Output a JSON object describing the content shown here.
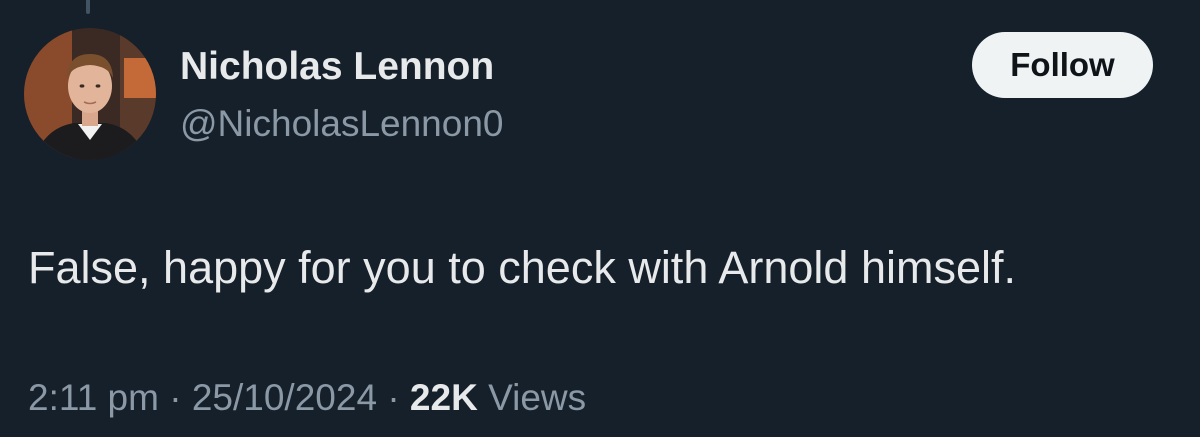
{
  "author": {
    "name": "Nicholas Lennon",
    "handle": "@NicholasLennon0"
  },
  "follow_button": {
    "label": "Follow"
  },
  "post": {
    "text": "False, happy for you to check with Arnold himself."
  },
  "meta": {
    "time": "2:11 pm",
    "separator": "·",
    "date": "25/10/2024",
    "views_count": "22K",
    "views_label": "Views"
  },
  "colors": {
    "background": "#15202b",
    "primary_text": "#e7e9ea",
    "secondary_text": "#8b98a5",
    "button_bg": "#eff3f4",
    "button_text": "#0f1419"
  }
}
